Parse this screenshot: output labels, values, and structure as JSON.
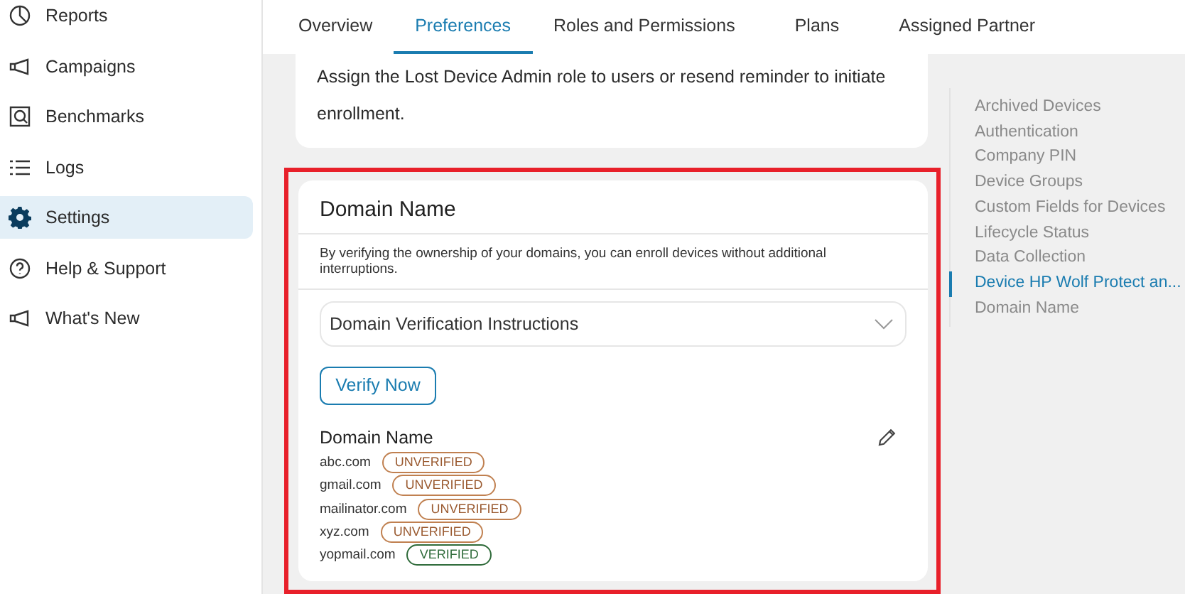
{
  "sidebar": {
    "items": [
      {
        "kind": "pie",
        "label": "Reports",
        "selected": false
      },
      {
        "kind": "megaphone",
        "label": "Campaigns",
        "selected": false
      },
      {
        "kind": "search",
        "label": "Benchmarks",
        "selected": false
      },
      {
        "kind": "list",
        "label": "Logs",
        "selected": false
      },
      {
        "kind": "gear",
        "label": "Settings",
        "selected": true
      },
      {
        "kind": "help",
        "label": "Help & Support",
        "selected": false
      },
      {
        "kind": "megaphone",
        "label": "What's New",
        "selected": false
      }
    ]
  },
  "tabs": [
    {
      "label": "Overview",
      "selected": false
    },
    {
      "label": "Preferences",
      "selected": true
    },
    {
      "label": "Roles and Permissions",
      "selected": false
    },
    {
      "label": "Plans",
      "selected": false
    },
    {
      "label": "Assigned Partner",
      "selected": false
    }
  ],
  "lost_device_card": {
    "text": "Assign the Lost Device Admin role to users or resend reminder to initiate enrollment."
  },
  "domain_card": {
    "highlighted": true,
    "title": "Domain Name",
    "description": "By verifying the ownership of your domains, you can enroll devices without additional interruptions.",
    "accordion": {
      "label": "Domain Verification Instructions",
      "expanded": false
    },
    "verify_button": "Verify Now",
    "list_title": "Domain Name",
    "domains": [
      {
        "name": "abc.com",
        "status": "UNVERIFIED",
        "verified": false
      },
      {
        "name": "gmail.com",
        "status": "UNVERIFIED",
        "verified": false
      },
      {
        "name": "mailinator.com",
        "status": "UNVERIFIED",
        "verified": false
      },
      {
        "name": "xyz.com",
        "status": "UNVERIFIED",
        "verified": false
      },
      {
        "name": "yopmail.com",
        "status": "VERIFIED",
        "verified": true
      }
    ]
  },
  "section_nav": {
    "items": [
      {
        "label": "Archived Devices",
        "selected": false
      },
      {
        "label": "Authentication",
        "selected": false
      },
      {
        "label": "Company PIN",
        "selected": false
      },
      {
        "label": "Device Groups",
        "selected": false
      },
      {
        "label": "Custom Fields for Devices",
        "selected": false
      },
      {
        "label": "Lifecycle Status",
        "selected": false
      },
      {
        "label": "Data Collection",
        "selected": false
      },
      {
        "label": "Device HP Wolf Protect an...",
        "selected": true
      },
      {
        "label": "Domain Name",
        "selected": false
      }
    ]
  }
}
